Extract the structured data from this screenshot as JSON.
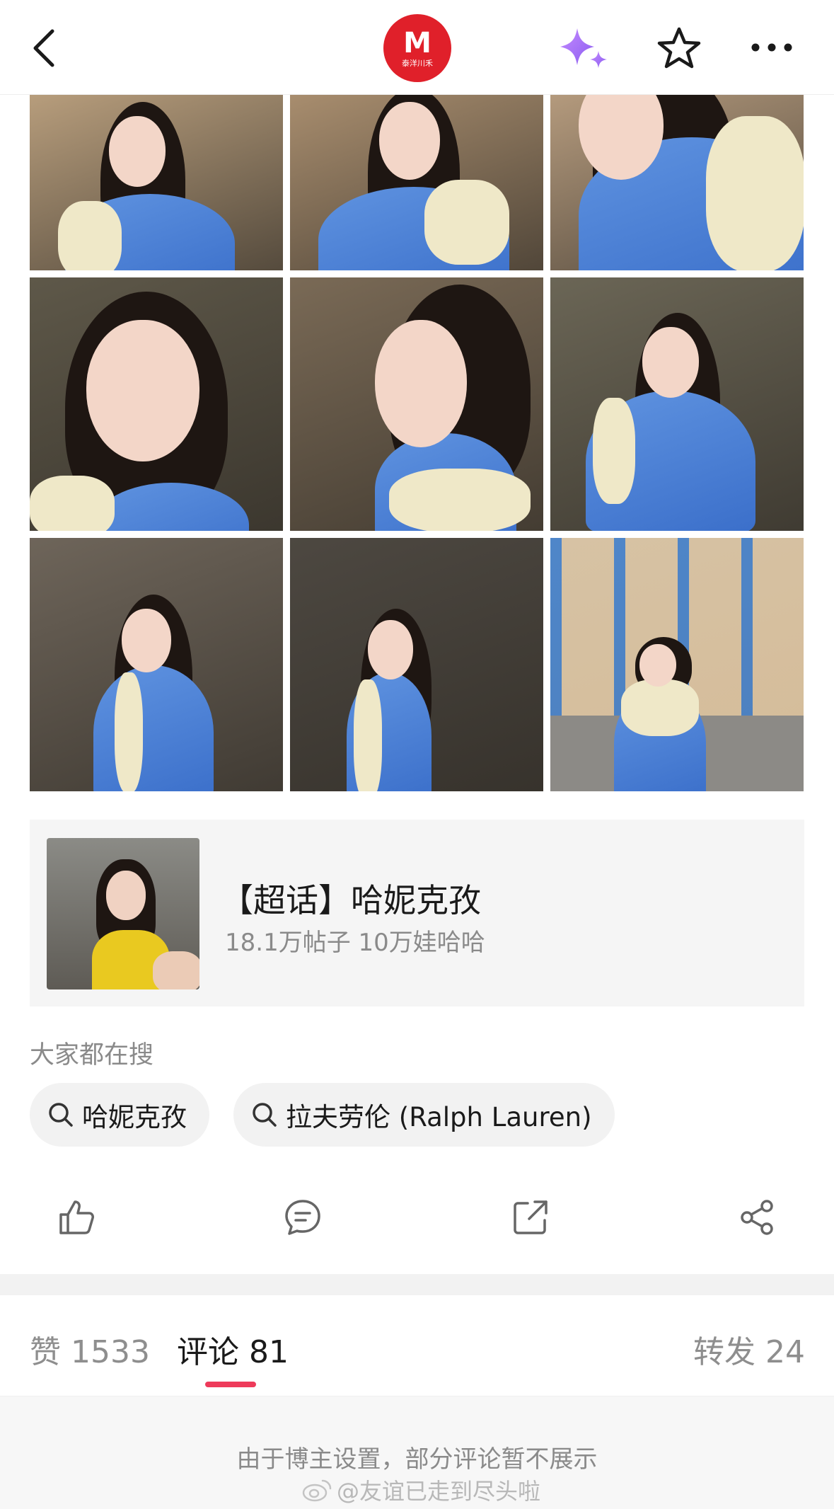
{
  "header": {
    "back_icon": "chevron-left-icon",
    "logo_main": "M",
    "logo_sub": "泰洋川禾",
    "sparkle_icon": "sparkle-icon",
    "star_icon": "star-icon",
    "more_icon": "more-horizontal-icon"
  },
  "photos": [
    {
      "id": 1,
      "bg": "#b79d7c",
      "alt": "photo-1"
    },
    {
      "id": 2,
      "bg": "#a88d6e",
      "alt": "photo-2"
    },
    {
      "id": 3,
      "bg": "#b49a7d",
      "alt": "photo-3"
    },
    {
      "id": 4,
      "bg": "#5e5849",
      "alt": "photo-4"
    },
    {
      "id": 5,
      "bg": "#7a6a56",
      "alt": "photo-5"
    },
    {
      "id": 6,
      "bg": "#6b6656",
      "alt": "photo-6"
    },
    {
      "id": 7,
      "bg": "#6e655a",
      "alt": "photo-7"
    },
    {
      "id": 8,
      "bg": "#4d4841",
      "alt": "photo-8"
    },
    {
      "id": 9,
      "bg": "#4f86c9",
      "alt": "photo-9"
    }
  ],
  "topic": {
    "title": "【超话】哈妮克孜",
    "stats": "18.1万帖子 10万娃哈哈"
  },
  "search": {
    "label": "大家都在搜",
    "chips": [
      {
        "text": "哈妮克孜"
      },
      {
        "text": "拉夫劳伦 (Ralph Lauren)"
      }
    ]
  },
  "actions": {
    "like_icon": "thumbs-up-icon",
    "comment_icon": "comment-icon",
    "repost_icon": "repost-icon",
    "share_icon": "share-icon"
  },
  "tabs": {
    "likes": "赞 1533",
    "comments": "评论 81",
    "reposts": "转发 24",
    "active": "comments"
  },
  "notice": "由于博主设置，部分评论暂不展示",
  "watermark": "@友谊已走到尽头啦",
  "colors": {
    "accent": "#ee3a5a",
    "logo_red": "#e0202a",
    "sparkle": "#a86ef0"
  }
}
